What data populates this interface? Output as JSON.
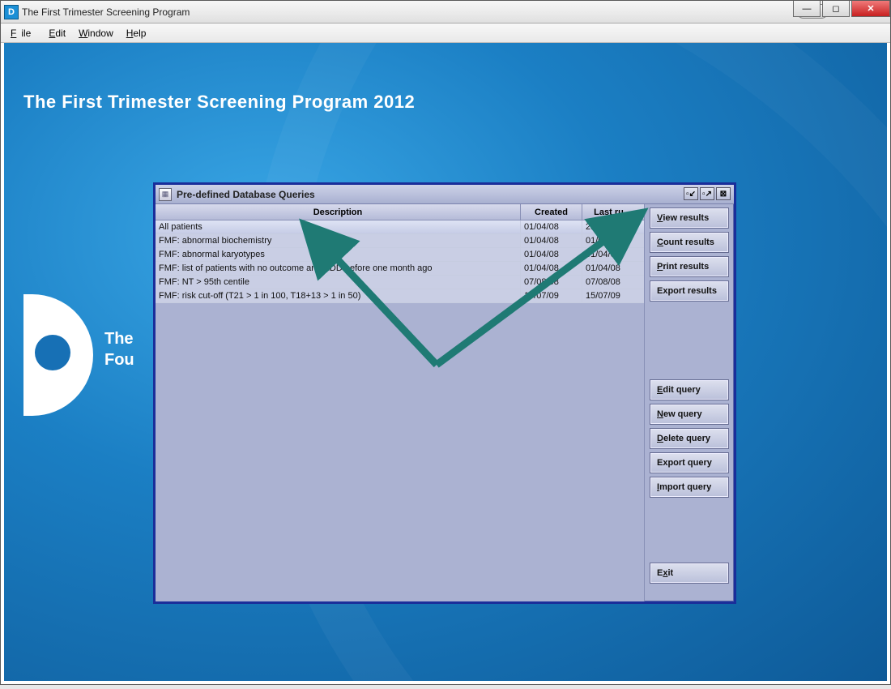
{
  "window": {
    "title": "The First Trimester Screening Program",
    "app_icon_letter": "D"
  },
  "menubar": {
    "file": "File",
    "edit": "Edit",
    "window": "Window",
    "help": "Help"
  },
  "page_heading": "The First Trimester Screening Program 2012",
  "logo": {
    "line1": "The",
    "line2": "Fou"
  },
  "inner": {
    "title": "Pre-defined Database Queries",
    "columns": {
      "description": "Description",
      "created": "Created",
      "last_run": "Last ru…"
    },
    "rows": [
      {
        "desc": "All patients",
        "created": "01/04/08",
        "last_run": "21/05/15",
        "selected": true
      },
      {
        "desc": "FMF: abnormal biochemistry",
        "created": "01/04/08",
        "last_run": "01/04/08",
        "selected": false
      },
      {
        "desc": "FMF: abnormal karyotypes",
        "created": "01/04/08",
        "last_run": "01/04/08",
        "selected": false
      },
      {
        "desc": "FMF: list of patients with no outcome and EDD before one month ago",
        "created": "01/04/08",
        "last_run": "01/04/08",
        "selected": false
      },
      {
        "desc": "FMF: NT > 95th centile",
        "created": "07/08/08",
        "last_run": "07/08/08",
        "selected": false
      },
      {
        "desc": "FMF: risk cut-off (T21 > 1 in 100, T18+13 > 1 in 50)",
        "created": "15/07/09",
        "last_run": "15/07/09",
        "selected": false
      }
    ],
    "buttons": {
      "view_results": "View results",
      "count_results": "Count results",
      "print_results": "Print results",
      "export_results": "Export results",
      "edit_query": "Edit query",
      "new_query": "New query",
      "delete_query": "Delete query",
      "export_query": "Export query",
      "import_query": "Import query",
      "exit": "Exit"
    }
  }
}
